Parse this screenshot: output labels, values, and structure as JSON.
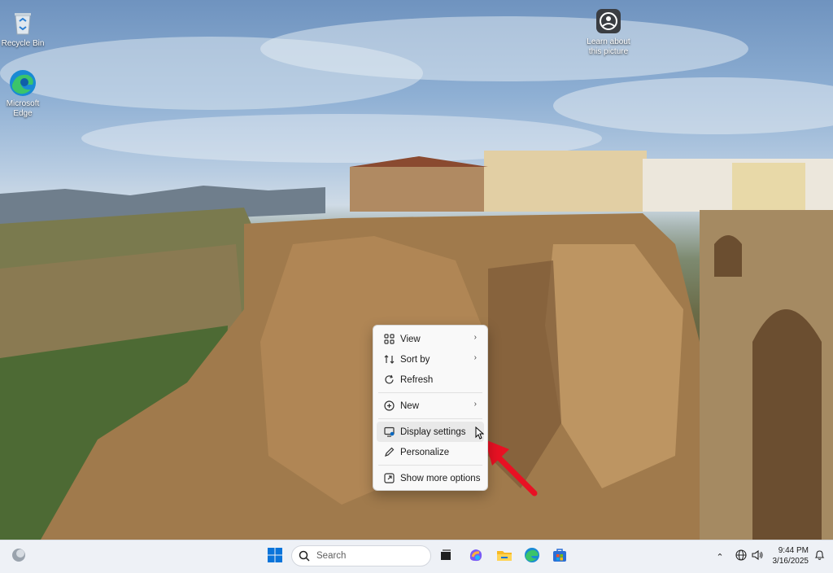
{
  "desktop": {
    "icons": [
      {
        "label": "Recycle Bin",
        "icon": "recycle-bin-icon"
      },
      {
        "label": "Microsoft Edge",
        "icon": "edge-icon"
      },
      {
        "label": "Learn about this picture",
        "icon": "camera-info-icon"
      }
    ]
  },
  "context_menu": {
    "items": [
      {
        "label": "View",
        "icon": "grid-icon",
        "submenu": true
      },
      {
        "label": "Sort by",
        "icon": "sort-icon",
        "submenu": true
      },
      {
        "label": "Refresh",
        "icon": "refresh-icon"
      },
      {
        "label": "New",
        "icon": "plus-circle-icon",
        "submenu": true
      },
      {
        "label": "Display settings",
        "icon": "display-settings-icon",
        "hovered": true
      },
      {
        "label": "Personalize",
        "icon": "pen-icon"
      },
      {
        "label": "Show more options",
        "icon": "expand-icon"
      }
    ]
  },
  "taskbar": {
    "search_placeholder": "Search",
    "time": "9:44 PM",
    "date": "3/16/2025",
    "apps": [
      "start-icon",
      "task-view-icon",
      "copilot-icon",
      "file-explorer-icon",
      "edge-icon",
      "store-icon"
    ]
  },
  "colors": {
    "accent": "#0067c0",
    "arrow": "#e81123",
    "menu_bg": "#f9f9f9",
    "taskbar_bg": "#eef1f6"
  }
}
